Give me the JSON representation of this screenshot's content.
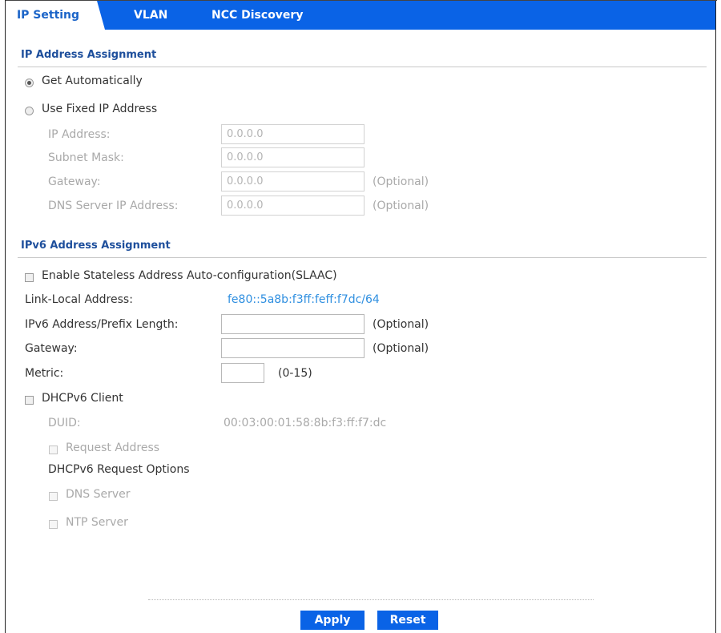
{
  "tabs": [
    {
      "label": "IP Setting"
    },
    {
      "label": "VLAN"
    },
    {
      "label": "NCC Discovery"
    }
  ],
  "ipv4": {
    "section_title": "IP Address Assignment",
    "get_automatically": "Get Automatically",
    "use_fixed": "Use Fixed IP Address",
    "ip_address": {
      "label": "IP Address:",
      "value": "0.0.0.0"
    },
    "subnet_mask": {
      "label": "Subnet Mask:",
      "value": "0.0.0.0"
    },
    "gateway": {
      "label": "Gateway:",
      "value": "0.0.0.0",
      "note": "(Optional)"
    },
    "dns": {
      "label": "DNS Server IP Address:",
      "value": "0.0.0.0",
      "note": "(Optional)"
    },
    "selected": "get_automatically"
  },
  "ipv6": {
    "section_title": "IPv6 Address Assignment",
    "slaac": "Enable Stateless Address Auto-configuration(SLAAC)",
    "link_local": {
      "label": "Link-Local Address:",
      "value": "fe80::5a8b:f3ff:feff:f7dc/64"
    },
    "prefix": {
      "label": "IPv6 Address/Prefix Length:",
      "value": "",
      "note": "(Optional)"
    },
    "gateway": {
      "label": "Gateway:",
      "value": "",
      "note": "(Optional)"
    },
    "metric": {
      "label": "Metric:",
      "value": "",
      "note": "(0-15)"
    },
    "dhcpv6_client": "DHCPv6 Client",
    "duid": {
      "label": "DUID:",
      "value": "00:03:00:01:58:8b:f3:ff:f7:dc"
    },
    "request_address": "Request Address",
    "request_options": "DHCPv6 Request Options",
    "dns_server": "DNS Server",
    "ntp_server": "NTP Server"
  },
  "buttons": {
    "apply": "Apply",
    "reset": "Reset"
  },
  "colors": {
    "accent": "#0a63e6",
    "section_title": "#1e4f9c",
    "link": "#2f8fe0"
  }
}
